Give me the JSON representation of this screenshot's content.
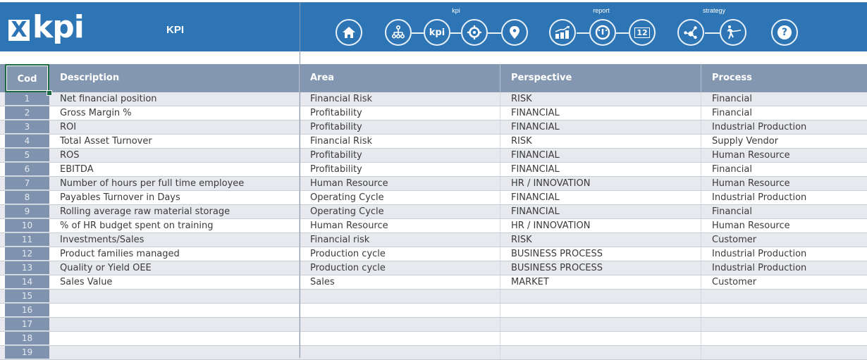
{
  "header": {
    "logo_mark": "X",
    "logo_text": "kpi",
    "sheet_title": "KPI",
    "group_labels": {
      "kpi": "kpi",
      "report": "report",
      "strategy": "strategy"
    },
    "nav": {
      "home": {
        "icon": "home-icon"
      },
      "org": {
        "icon": "org-chart-icon"
      },
      "kpi": {
        "icon": "kpi-icon",
        "glyph": "kpi"
      },
      "target": {
        "icon": "target-icon"
      },
      "location": {
        "icon": "map-pin-icon"
      },
      "chart": {
        "icon": "bar-chart-icon"
      },
      "gauge": {
        "icon": "gauge-icon"
      },
      "calendar": {
        "icon": "calendar-icon",
        "glyph": "12"
      },
      "share": {
        "icon": "share-icon"
      },
      "strategy": {
        "icon": "athlete-icon"
      },
      "help": {
        "icon": "help-icon",
        "glyph": "?"
      }
    },
    "colors": {
      "banner": "#2e75b6",
      "table_header": "#8497b0",
      "cod_column": "#7f93ae"
    }
  },
  "table": {
    "columns": [
      "Cod",
      "Description",
      "Area",
      "Perspective",
      "Process"
    ],
    "rows": [
      {
        "cod": "1",
        "description": "Net financial position",
        "area": "Financial Risk",
        "perspective": "RISK",
        "process": "Financial"
      },
      {
        "cod": "2",
        "description": "Gross Margin %",
        "area": "Profitability",
        "perspective": "FINANCIAL",
        "process": "Financial"
      },
      {
        "cod": "3",
        "description": "ROI",
        "area": "Profitability",
        "perspective": "FINANCIAL",
        "process": "Industrial Production"
      },
      {
        "cod": "4",
        "description": "Total Asset Turnover",
        "area": "Financial Risk",
        "perspective": "RISK",
        "process": "Supply Vendor"
      },
      {
        "cod": "5",
        "description": "ROS",
        "area": "Profitability",
        "perspective": "FINANCIAL",
        "process": "Human Resource"
      },
      {
        "cod": "6",
        "description": "EBITDA",
        "area": "Profitability",
        "perspective": "FINANCIAL",
        "process": "Financial"
      },
      {
        "cod": "7",
        "description": "Number of hours per full time employee",
        "area": "Human Resource",
        "perspective": "HR / INNOVATION",
        "process": "Human Resource"
      },
      {
        "cod": "8",
        "description": "Payables Turnover in Days",
        "area": "Operating Cycle",
        "perspective": "FINANCIAL",
        "process": "Industrial Production"
      },
      {
        "cod": "9",
        "description": "Rolling average raw material storage",
        "area": "Operating Cycle",
        "perspective": "FINANCIAL",
        "process": "Financial"
      },
      {
        "cod": "10",
        "description": "% of HR budget spent on training",
        "area": "Human Resource",
        "perspective": "HR / INNOVATION",
        "process": "Human Resource"
      },
      {
        "cod": "11",
        "description": "Investments/Sales",
        "area": "Financial risk",
        "perspective": "RISK",
        "process": "Customer"
      },
      {
        "cod": "12",
        "description": "Product families managed",
        "area": "Production cycle",
        "perspective": "BUSINESS PROCESS",
        "process": "Industrial Production"
      },
      {
        "cod": "13",
        "description": "Quality or Yield OEE",
        "area": "Production cycle",
        "perspective": "BUSINESS PROCESS",
        "process": "Industrial Production"
      },
      {
        "cod": "14",
        "description": "Sales Value",
        "area": "Sales",
        "perspective": "MARKET",
        "process": "Customer"
      },
      {
        "cod": "15",
        "description": "",
        "area": "",
        "perspective": "",
        "process": ""
      },
      {
        "cod": "16",
        "description": "",
        "area": "",
        "perspective": "",
        "process": ""
      },
      {
        "cod": "17",
        "description": "",
        "area": "",
        "perspective": "",
        "process": ""
      },
      {
        "cod": "18",
        "description": "",
        "area": "",
        "perspective": "",
        "process": ""
      },
      {
        "cod": "19",
        "description": "",
        "area": "",
        "perspective": "",
        "process": ""
      }
    ]
  }
}
